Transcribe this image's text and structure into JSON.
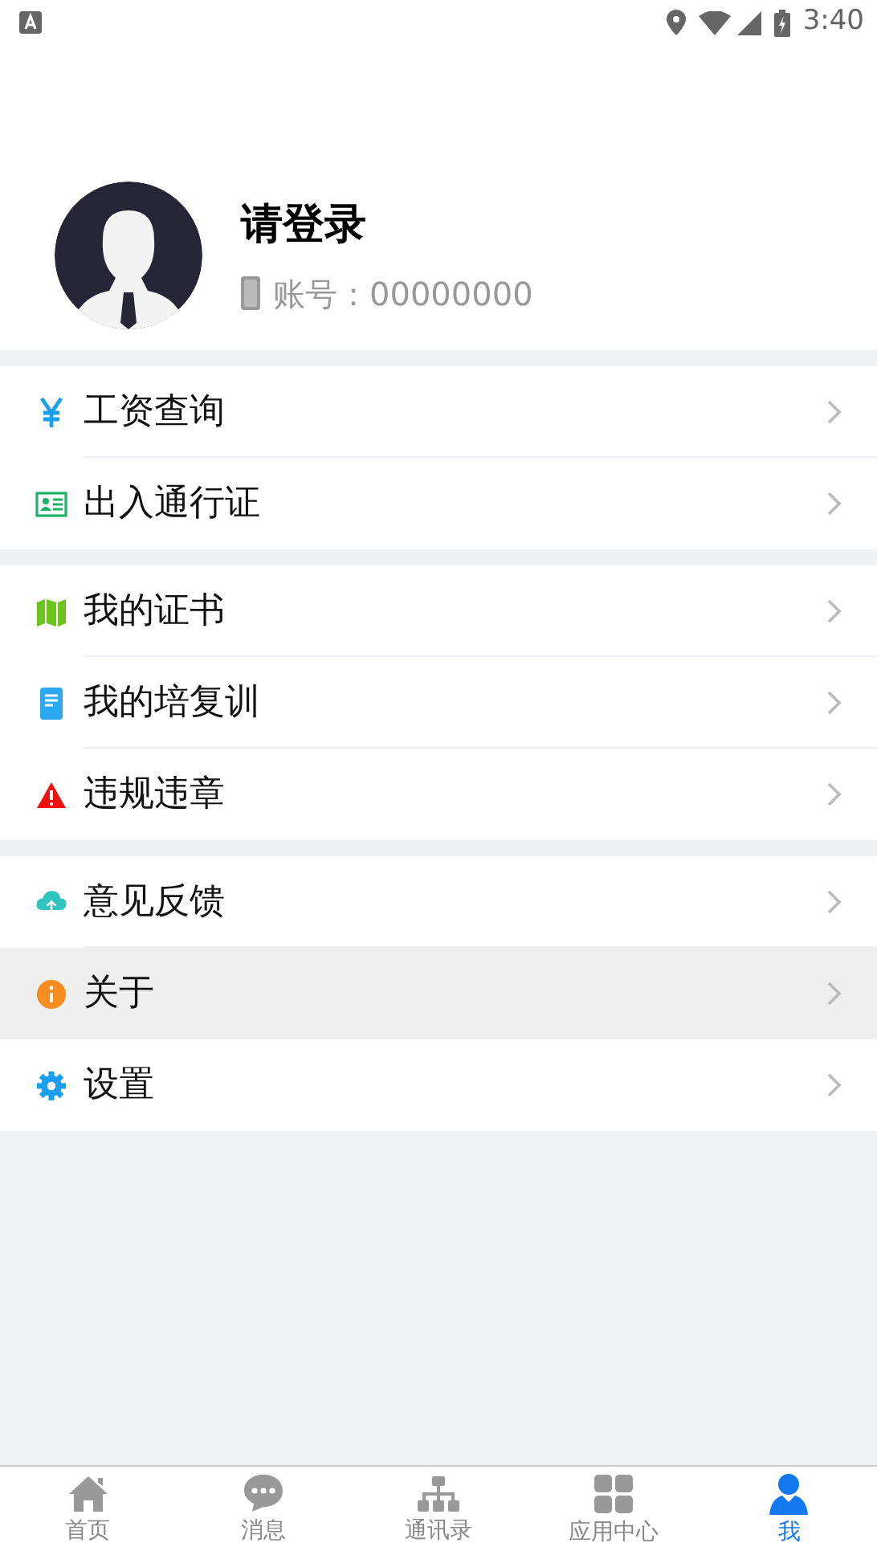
{
  "status_bar": {
    "time": "3:40"
  },
  "profile": {
    "name": "请登录",
    "account_label": "账号：",
    "account": "00000000"
  },
  "menu_groups": [
    {
      "items": [
        {
          "label": "工资查询",
          "highlighted": false
        },
        {
          "label": "出入通行证",
          "highlighted": false
        }
      ]
    },
    {
      "items": [
        {
          "label": "我的证书",
          "highlighted": false
        },
        {
          "label": "我的培复训",
          "highlighted": false
        },
        {
          "label": "违规违章",
          "highlighted": false
        }
      ]
    },
    {
      "items": [
        {
          "label": "意见反馈",
          "highlighted": false
        },
        {
          "label": "关于",
          "highlighted": true
        },
        {
          "label": "设置",
          "highlighted": false
        }
      ]
    }
  ],
  "tab_bar": [
    {
      "label": "首页",
      "selected": false
    },
    {
      "label": "消息",
      "selected": false
    },
    {
      "label": "通讯录",
      "selected": false
    },
    {
      "label": "应用中心",
      "selected": false
    },
    {
      "label": "我",
      "selected": true
    }
  ]
}
